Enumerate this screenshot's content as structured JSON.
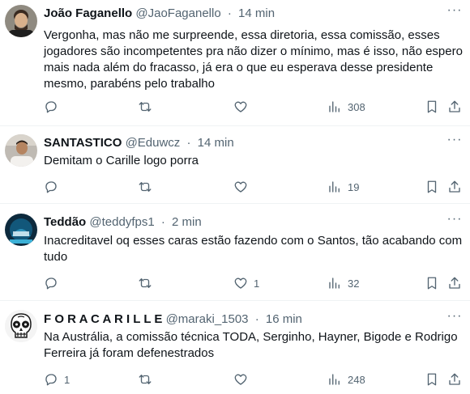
{
  "tweets": [
    {
      "name": "João Faganello",
      "handle": "@JaoFaganello",
      "time": "14 min",
      "text": "Vergonha, mas não me surpreende, essa diretoria, essa comissão, esses\njogadores são incompetentes pra não dizer o mínimo, mas é isso, não espero\nmais nada além do fracasso, já era o que eu esperava desse presidente\nmesmo, parabéns pelo trabalho",
      "replies": "",
      "retweets": "",
      "likes": "",
      "views": "308"
    },
    {
      "name": "SANTASTICO",
      "handle": "@Eduwcz",
      "time": "14 min",
      "text": "Demitam o Carille logo porra",
      "replies": "",
      "retweets": "",
      "likes": "",
      "views": "19"
    },
    {
      "name": "Teddão",
      "handle": "@teddyfps1",
      "time": "2 min",
      "text": "Inacreditavel oq esses caras estão fazendo com o Santos, tão acabando com\ntudo",
      "replies": "",
      "retweets": "",
      "likes": "1",
      "views": "32"
    },
    {
      "name": "F O R A C A R I L L E",
      "handle": "@maraki_1503",
      "time": "16 min",
      "text": "Na Austrália, a comissão técnica TODA, Serginho, Hayner, Bigode e Rodrigo\nFerreira já foram defenestrados",
      "replies": "1",
      "retweets": "",
      "likes": "",
      "views": "248"
    }
  ],
  "separator": "·",
  "more_label": "···",
  "icons": {
    "reply": "reply-icon",
    "retweet": "retweet-icon",
    "like": "heart-icon",
    "views": "views-icon",
    "bookmark": "bookmark-icon",
    "share": "share-icon"
  },
  "colors": {
    "text": "#0f1419",
    "secondary": "#536471",
    "divider": "#eff3f4"
  }
}
